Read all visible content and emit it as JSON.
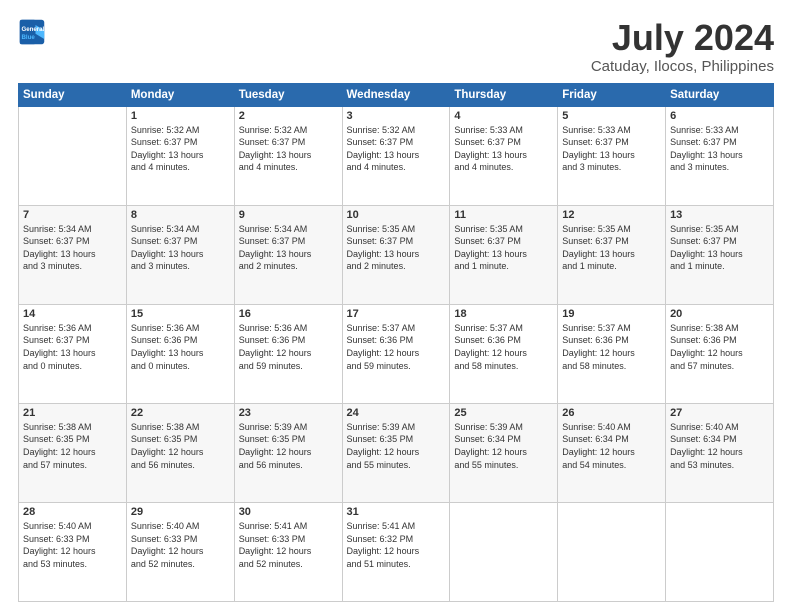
{
  "header": {
    "logo_line1": "General",
    "logo_line2": "Blue",
    "month": "July 2024",
    "location": "Catuday, Ilocos, Philippines"
  },
  "days_of_week": [
    "Sunday",
    "Monday",
    "Tuesday",
    "Wednesday",
    "Thursday",
    "Friday",
    "Saturday"
  ],
  "weeks": [
    [
      {
        "day": "",
        "text": ""
      },
      {
        "day": "1",
        "text": "Sunrise: 5:32 AM\nSunset: 6:37 PM\nDaylight: 13 hours\nand 4 minutes."
      },
      {
        "day": "2",
        "text": "Sunrise: 5:32 AM\nSunset: 6:37 PM\nDaylight: 13 hours\nand 4 minutes."
      },
      {
        "day": "3",
        "text": "Sunrise: 5:32 AM\nSunset: 6:37 PM\nDaylight: 13 hours\nand 4 minutes."
      },
      {
        "day": "4",
        "text": "Sunrise: 5:33 AM\nSunset: 6:37 PM\nDaylight: 13 hours\nand 4 minutes."
      },
      {
        "day": "5",
        "text": "Sunrise: 5:33 AM\nSunset: 6:37 PM\nDaylight: 13 hours\nand 3 minutes."
      },
      {
        "day": "6",
        "text": "Sunrise: 5:33 AM\nSunset: 6:37 PM\nDaylight: 13 hours\nand 3 minutes."
      }
    ],
    [
      {
        "day": "7",
        "text": "Sunrise: 5:34 AM\nSunset: 6:37 PM\nDaylight: 13 hours\nand 3 minutes."
      },
      {
        "day": "8",
        "text": "Sunrise: 5:34 AM\nSunset: 6:37 PM\nDaylight: 13 hours\nand 3 minutes."
      },
      {
        "day": "9",
        "text": "Sunrise: 5:34 AM\nSunset: 6:37 PM\nDaylight: 13 hours\nand 2 minutes."
      },
      {
        "day": "10",
        "text": "Sunrise: 5:35 AM\nSunset: 6:37 PM\nDaylight: 13 hours\nand 2 minutes."
      },
      {
        "day": "11",
        "text": "Sunrise: 5:35 AM\nSunset: 6:37 PM\nDaylight: 13 hours\nand 1 minute."
      },
      {
        "day": "12",
        "text": "Sunrise: 5:35 AM\nSunset: 6:37 PM\nDaylight: 13 hours\nand 1 minute."
      },
      {
        "day": "13",
        "text": "Sunrise: 5:35 AM\nSunset: 6:37 PM\nDaylight: 13 hours\nand 1 minute."
      }
    ],
    [
      {
        "day": "14",
        "text": "Sunrise: 5:36 AM\nSunset: 6:37 PM\nDaylight: 13 hours\nand 0 minutes."
      },
      {
        "day": "15",
        "text": "Sunrise: 5:36 AM\nSunset: 6:36 PM\nDaylight: 13 hours\nand 0 minutes."
      },
      {
        "day": "16",
        "text": "Sunrise: 5:36 AM\nSunset: 6:36 PM\nDaylight: 12 hours\nand 59 minutes."
      },
      {
        "day": "17",
        "text": "Sunrise: 5:37 AM\nSunset: 6:36 PM\nDaylight: 12 hours\nand 59 minutes."
      },
      {
        "day": "18",
        "text": "Sunrise: 5:37 AM\nSunset: 6:36 PM\nDaylight: 12 hours\nand 58 minutes."
      },
      {
        "day": "19",
        "text": "Sunrise: 5:37 AM\nSunset: 6:36 PM\nDaylight: 12 hours\nand 58 minutes."
      },
      {
        "day": "20",
        "text": "Sunrise: 5:38 AM\nSunset: 6:36 PM\nDaylight: 12 hours\nand 57 minutes."
      }
    ],
    [
      {
        "day": "21",
        "text": "Sunrise: 5:38 AM\nSunset: 6:35 PM\nDaylight: 12 hours\nand 57 minutes."
      },
      {
        "day": "22",
        "text": "Sunrise: 5:38 AM\nSunset: 6:35 PM\nDaylight: 12 hours\nand 56 minutes."
      },
      {
        "day": "23",
        "text": "Sunrise: 5:39 AM\nSunset: 6:35 PM\nDaylight: 12 hours\nand 56 minutes."
      },
      {
        "day": "24",
        "text": "Sunrise: 5:39 AM\nSunset: 6:35 PM\nDaylight: 12 hours\nand 55 minutes."
      },
      {
        "day": "25",
        "text": "Sunrise: 5:39 AM\nSunset: 6:34 PM\nDaylight: 12 hours\nand 55 minutes."
      },
      {
        "day": "26",
        "text": "Sunrise: 5:40 AM\nSunset: 6:34 PM\nDaylight: 12 hours\nand 54 minutes."
      },
      {
        "day": "27",
        "text": "Sunrise: 5:40 AM\nSunset: 6:34 PM\nDaylight: 12 hours\nand 53 minutes."
      }
    ],
    [
      {
        "day": "28",
        "text": "Sunrise: 5:40 AM\nSunset: 6:33 PM\nDaylight: 12 hours\nand 53 minutes."
      },
      {
        "day": "29",
        "text": "Sunrise: 5:40 AM\nSunset: 6:33 PM\nDaylight: 12 hours\nand 52 minutes."
      },
      {
        "day": "30",
        "text": "Sunrise: 5:41 AM\nSunset: 6:33 PM\nDaylight: 12 hours\nand 52 minutes."
      },
      {
        "day": "31",
        "text": "Sunrise: 5:41 AM\nSunset: 6:32 PM\nDaylight: 12 hours\nand 51 minutes."
      },
      {
        "day": "",
        "text": ""
      },
      {
        "day": "",
        "text": ""
      },
      {
        "day": "",
        "text": ""
      }
    ]
  ]
}
